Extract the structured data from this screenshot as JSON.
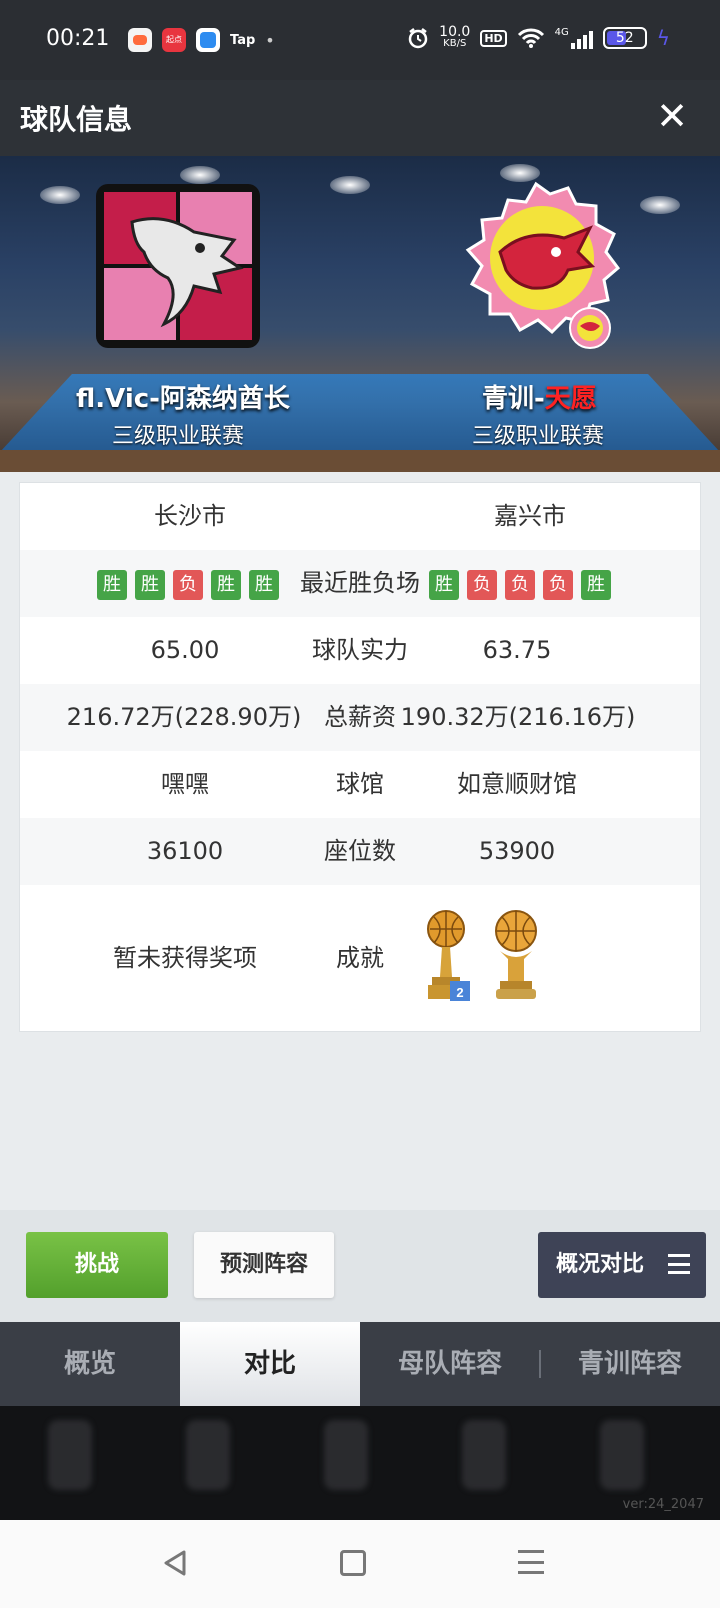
{
  "status_bar": {
    "time": "00:21",
    "app_tap": "Tap",
    "qidian_label": "起点",
    "net_speed": "10.0",
    "net_unit": "KB/S",
    "hd": "HD",
    "signal": "4G",
    "battery": "52",
    "battery_level": 0.52
  },
  "header": {
    "title": "球队信息",
    "close_glyph": "✕"
  },
  "teams": {
    "home": {
      "name": "fl.Vic-阿森纳酋长",
      "league": "三级职业联赛",
      "city": "长沙市",
      "rating": "65.00",
      "salary": "216.72万(228.90万)",
      "arena": "嘿嘿",
      "seats": "36100",
      "awards": "暂未获得奖项"
    },
    "away": {
      "name_prefix": "青训-",
      "name_highlight": "天愿",
      "league": "三级职业联赛",
      "city": "嘉兴市",
      "rating": "63.75",
      "salary": "190.32万(216.16万)",
      "arena": "如意顺财馆",
      "seats": "53900",
      "trophy_badge": "2"
    }
  },
  "labels": {
    "recent_form": "最近胜负场",
    "strength": "球队实力",
    "total_salary": "总薪资",
    "arena": "球馆",
    "seats": "座位数",
    "achievements": "成就"
  },
  "form": {
    "win": "胜",
    "loss": "负",
    "home": [
      "W",
      "W",
      "L",
      "W",
      "W"
    ],
    "away": [
      "W",
      "L",
      "L",
      "L",
      "W"
    ]
  },
  "actions": {
    "challenge": "挑战",
    "predict": "预测阵容",
    "compare": "概况对比"
  },
  "tabs": [
    {
      "label": "概览",
      "active": false
    },
    {
      "label": "对比",
      "active": true
    },
    {
      "label": "母队阵容",
      "active": false
    },
    {
      "label": "青训阵容",
      "active": false
    }
  ],
  "version": "ver:24_2047",
  "colors": {
    "win": "#45a447",
    "loss": "#e25757",
    "header_bg": "#2e3237",
    "challenge_green": "#5aa631"
  }
}
